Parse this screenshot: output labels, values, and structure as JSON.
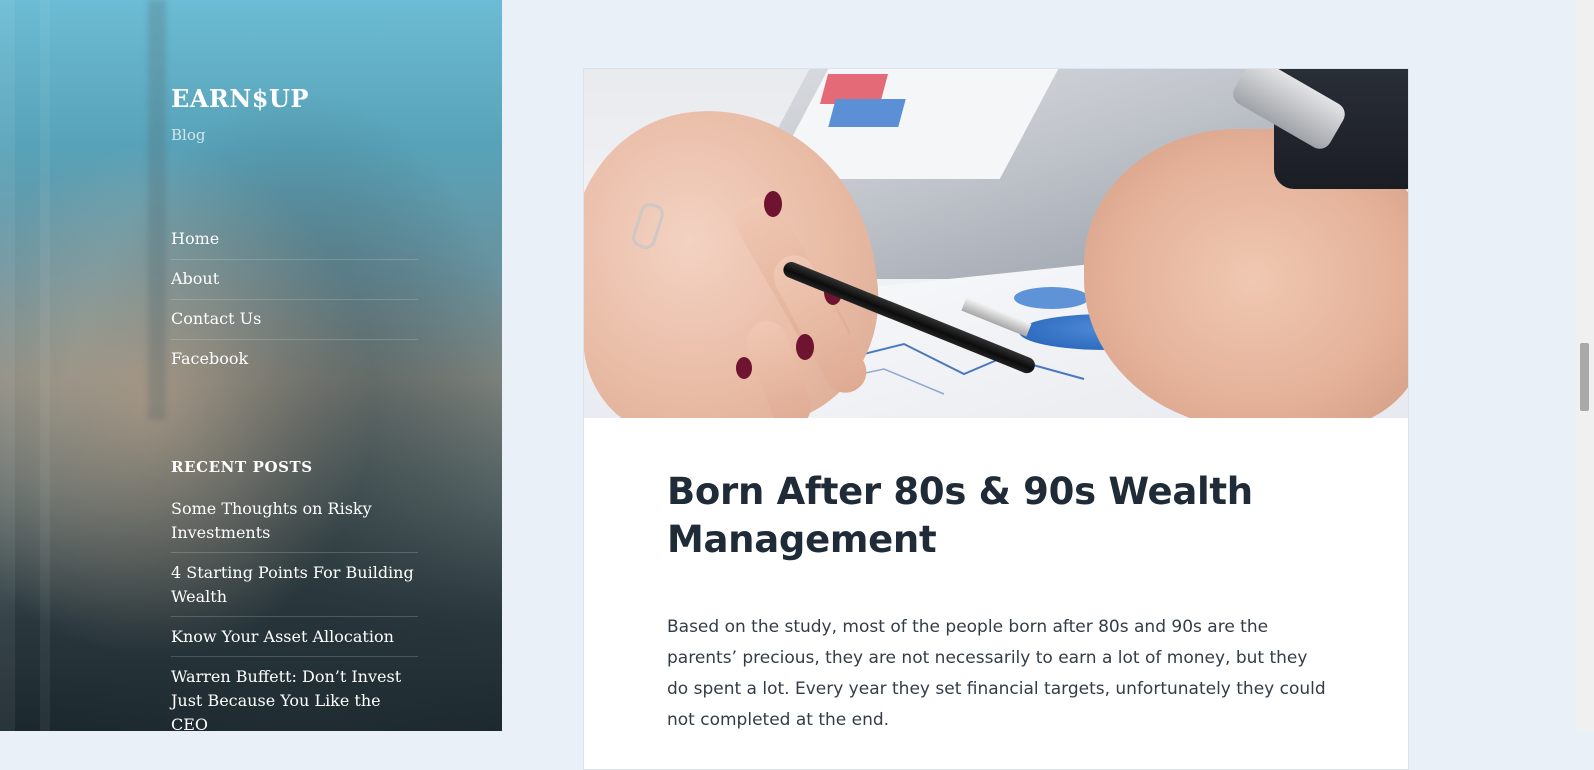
{
  "site": {
    "title": "EARN$UP",
    "description": "Blog"
  },
  "nav": {
    "items": [
      {
        "label": "Home"
      },
      {
        "label": "About"
      },
      {
        "label": "Contact Us"
      },
      {
        "label": "Facebook"
      }
    ]
  },
  "recent_posts": {
    "heading": "RECENT POSTS",
    "items": [
      {
        "label": "Some Thoughts on Risky Investments"
      },
      {
        "label": "4 Starting Points For Building Wealth"
      },
      {
        "label": "Know Your Asset Allocation"
      },
      {
        "label": "Warren Buffett: Don’t Invest Just Because You Like the CEO"
      }
    ]
  },
  "article": {
    "image_icon": "featured-image-business-hands-chart",
    "title": "Born After 80s & 90s Wealth Management",
    "excerpt": "Based on the study, most of the people born after 80s and 90s are the parents’ precious, they are not necessarily to earn a lot of money, but they do spent a lot.  Every year they set financial targets, unfortunately they could not completed at the end."
  },
  "colors": {
    "page_background": "#e9f0f8",
    "title_text": "#1f2b37",
    "body_text": "#333d47",
    "sidebar_text": "#ffffff"
  }
}
